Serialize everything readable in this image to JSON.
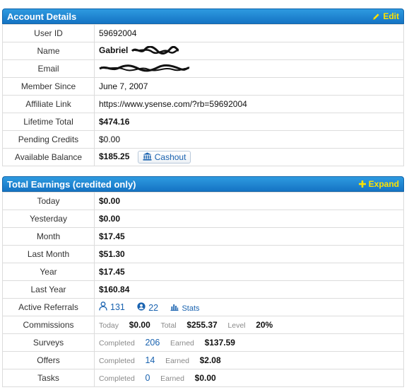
{
  "account": {
    "title": "Account Details",
    "edit_label": "Edit",
    "rows": {
      "user_id": {
        "label": "User ID",
        "value": "59692004"
      },
      "name": {
        "label": "Name",
        "value": "Gabriel"
      },
      "email": {
        "label": "Email"
      },
      "member_since": {
        "label": "Member Since",
        "value": "June 7, 2007"
      },
      "affiliate": {
        "label": "Affiliate Link",
        "value": "https://www.ysense.com/?rb=59692004"
      },
      "lifetime": {
        "label": "Lifetime Total",
        "value": "$474.16"
      },
      "pending": {
        "label": "Pending Credits",
        "value": "$0.00"
      },
      "available": {
        "label": "Available Balance",
        "value": "$185.25",
        "button": "Cashout"
      }
    }
  },
  "earnings": {
    "title": "Total Earnings (credited only)",
    "expand_label": "Expand",
    "rows": {
      "today": {
        "label": "Today",
        "value": "$0.00"
      },
      "yesterday": {
        "label": "Yesterday",
        "value": "$0.00"
      },
      "month": {
        "label": "Month",
        "value": "$17.45"
      },
      "last_month": {
        "label": "Last Month",
        "value": "$51.30"
      },
      "year": {
        "label": "Year",
        "value": "$17.45"
      },
      "last_year": {
        "label": "Last Year",
        "value": "$160.84"
      },
      "referrals": {
        "label": "Active Referrals",
        "direct": "131",
        "indirect": "22",
        "stats": "Stats"
      },
      "commissions": {
        "label": "Commissions",
        "today_label": "Today",
        "today_value": "$0.00",
        "total_label": "Total",
        "total_value": "$255.37",
        "level_label": "Level",
        "level_value": "20%"
      },
      "surveys": {
        "label": "Surveys",
        "completed_label": "Completed",
        "completed": "206",
        "earned_label": "Earned",
        "earned": "$137.59"
      },
      "offers": {
        "label": "Offers",
        "completed_label": "Completed",
        "completed": "14",
        "earned_label": "Earned",
        "earned": "$2.08"
      },
      "tasks": {
        "label": "Tasks",
        "completed_label": "Completed",
        "completed": "0",
        "earned_label": "Earned",
        "earned": "$0.00"
      }
    }
  },
  "colors": {
    "header_blue": "#1d83d4",
    "header_action_yellow": "#ffe200",
    "link_blue": "#1a63b0"
  },
  "icons": [
    "pencil-icon",
    "plus-icon",
    "bank-icon",
    "user-outline-icon",
    "user-solid-icon",
    "bar-chart-icon"
  ]
}
